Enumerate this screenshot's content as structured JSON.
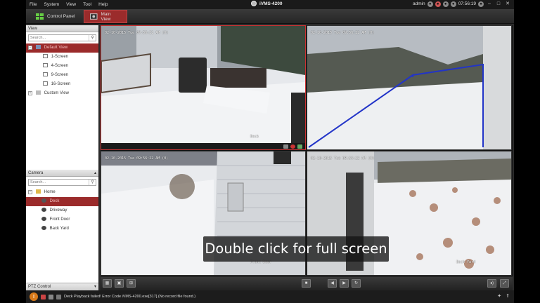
{
  "app": {
    "title": "iVMS-4200",
    "menu": [
      "File",
      "System",
      "View",
      "Tool",
      "Help"
    ],
    "user": "admin",
    "time": "07:56:19"
  },
  "tabs": [
    {
      "label": "Control Panel"
    },
    {
      "label": "Main View"
    }
  ],
  "view_panel": {
    "header": "View",
    "search_placeholder": "Search...",
    "items": [
      {
        "label": "Default View"
      },
      {
        "label": "1-Screen"
      },
      {
        "label": "4-Screen"
      },
      {
        "label": "9-Screen"
      },
      {
        "label": "16-Screen"
      },
      {
        "label": "Custom View"
      }
    ]
  },
  "camera_panel": {
    "header": "Camera",
    "search_placeholder": "Search...",
    "root": "Home",
    "cameras": [
      {
        "label": "Deck"
      },
      {
        "label": "Driveway"
      },
      {
        "label": "Front Door"
      },
      {
        "label": "Back Yard"
      }
    ]
  },
  "ptz": {
    "label": "PTZ Control"
  },
  "feeds": [
    {
      "osd": "02-10-2015 Tue 09:56:21 AM (0)",
      "name": "Deck"
    },
    {
      "osd": "02-10-2015 Tue 09:56:22 AM (0)",
      "name": ""
    },
    {
      "osd": "02-10-2015 Tue 09:56:22 AM (0)",
      "name": "Front Door"
    },
    {
      "osd": "02-10-2015 Tue 09:56:22 AM (0)",
      "name": "Back Yard"
    }
  ],
  "status": {
    "message": "Deck Playback failed! Error Code iVMS-4200.exe[317].(No record file found.)"
  },
  "caption": "Double click for full screen",
  "colors": {
    "accent": "#9b2b2b",
    "warning": "#d87a1a"
  }
}
